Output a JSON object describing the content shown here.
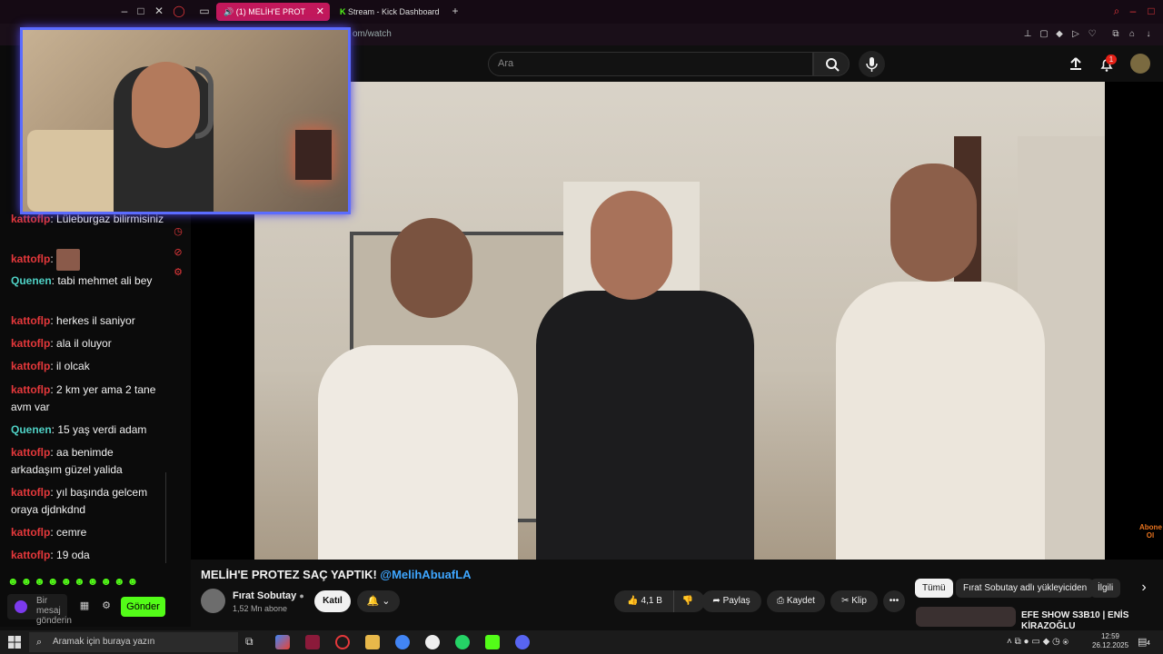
{
  "browser": {
    "tabs": [
      {
        "label": "(1) MELİH'E PROT",
        "active": true
      },
      {
        "label": "Stream - Kick Dashboard",
        "active": false
      }
    ],
    "new_tab_label": "+",
    "close_tab_label": "✕",
    "address_fragment": "om/watch"
  },
  "youtube": {
    "search_placeholder": "Ara",
    "notification_count": "1",
    "video_title_main": "MELİH'E PROTEZ SAÇ YAPTIK!",
    "video_title_tag": "@MelihAbuafLA",
    "channel_name": "Fırat Sobutay",
    "subscribers": "1,52 Mn abone",
    "join_label": "Katıl",
    "like_count": "4,1 B",
    "share_label": "Paylaş",
    "save_label": "Kaydet",
    "clip_label": "Klip",
    "more_label": "•••",
    "chips": [
      "Tümü",
      "Fırat Sobutay adlı yükleyiciden",
      "İlgili"
    ],
    "chip_next": "›",
    "recommendation_title": "EFE SHOW S3B10 | ENİS KİRAZOĞLU",
    "watermark": "Abone Ol"
  },
  "chat": {
    "messages": [
      {
        "user": "kattoflp",
        "text": "Lüleburgaz bilirmisiniz",
        "color": "red"
      },
      {
        "user": "kattoflp",
        "text": "",
        "color": "red",
        "emote": true
      },
      {
        "user": "Quenen",
        "text": "tabi mehmet ali bey",
        "color": "teal"
      },
      {
        "user": "kattoflp",
        "text": "herkes il saniyor",
        "color": "red"
      },
      {
        "user": "kattoflp",
        "text": "ala il oluyor",
        "color": "red"
      },
      {
        "user": "kattoflp",
        "text": "il olcak",
        "color": "red"
      },
      {
        "user": "kattoflp",
        "text": "2 km yer ama 2 tane avm var",
        "color": "red"
      },
      {
        "user": "Quenen",
        "text": "15 yaş verdi adam",
        "color": "teal"
      },
      {
        "user": "kattoflp",
        "text": "aa benimde arkadaşım güzel yalida",
        "color": "red"
      },
      {
        "user": "kattoflp",
        "text": "yıl başında gelcem oraya djdnkdnd",
        "color": "red"
      },
      {
        "user": "kattoflp",
        "text": "cemre",
        "color": "red"
      },
      {
        "user": "kattoflp",
        "text": "19 oda",
        "color": "red"
      }
    ],
    "input_placeholder": "Bir mesaj gönderin",
    "send_label": "Gönder",
    "colors": {
      "red": "#e5383b",
      "teal": "#4fd1c5",
      "send": "#53fc18"
    }
  },
  "taskbar": {
    "search_placeholder": "Aramak için buraya yazın",
    "time": "12:59",
    "date": "26.12.2025",
    "notification_count": "4"
  }
}
